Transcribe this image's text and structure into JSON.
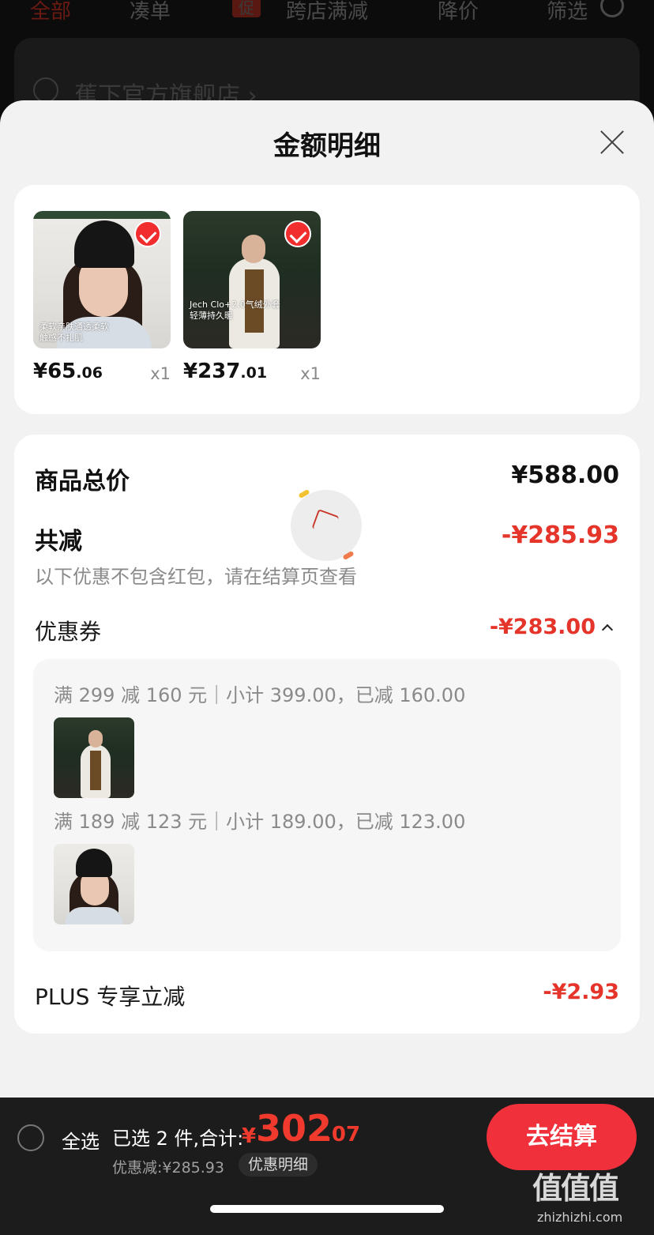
{
  "background": {
    "tabs": [
      "全部",
      "凑单",
      "跨店满减",
      "降价",
      "筛选"
    ],
    "promo_badge": "促",
    "store_name": "蕉下官方旗舰店",
    "store_chevron": "›"
  },
  "sheet": {
    "title": "金额明细",
    "products": [
      {
        "image": "black beanie portrait",
        "price_main": "¥65",
        "price_cents": ".06",
        "qty": "x1",
        "caption": "柔软亲肤通透柔软\n触感不扎肌"
      },
      {
        "image": "cream quilted jacket",
        "price_main": "¥237",
        "price_cents": ".01",
        "qty": "x1",
        "caption": "Jech Clo+2.0气绒外套\n轻薄持久暖"
      }
    ],
    "summary": {
      "total_label": "商品总价",
      "total_value": "¥588.00",
      "reduce_label": "共减",
      "reduce_value": "-¥285.93",
      "note": "以下优惠不包含红包，请在结算页查看",
      "coupon_label": "优惠券",
      "coupon_value": "-¥283.00",
      "coupon_rules": [
        {
          "text": "满 299 减 160 元｜小计 399.00，已减 160.00",
          "thumb": "jacket"
        },
        {
          "text": "满 189 减 123 元｜小计 189.00，已减 123.00",
          "thumb": "beanie"
        }
      ],
      "plus_label": "PLUS 专享立减",
      "plus_value": "-¥2.93"
    }
  },
  "bottom_bar": {
    "select_all": "全选",
    "selected_summary": "已选 2 件,合计:",
    "currency": "¥",
    "total_main": "302",
    "total_cents": ".07",
    "discount_text": "优惠减:¥285.93",
    "discount_detail": "优惠明细",
    "checkout": "去结算"
  },
  "watermark": {
    "logo": "值值值",
    "url": "zhizhizhi.com"
  },
  "colors": {
    "accent": "#e5342a",
    "checkout": "#f0303a",
    "sheet_bg": "#f2f2f2"
  }
}
